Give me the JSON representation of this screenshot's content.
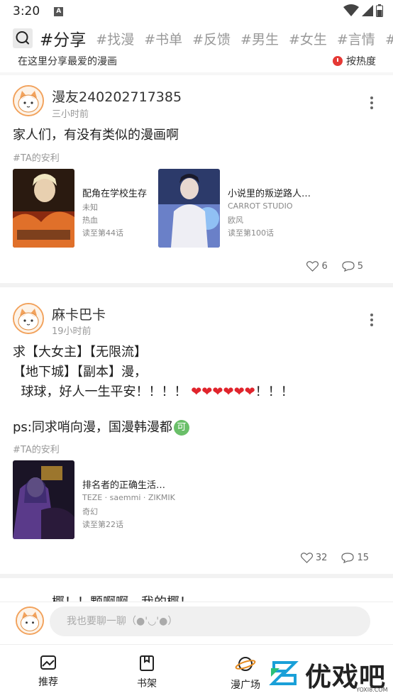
{
  "status_bar": {
    "time": "3:20",
    "notif_letter": "A"
  },
  "tabs": {
    "items": [
      "#分享",
      "#找漫",
      "#书单",
      "#反馈",
      "#男生",
      "#女生",
      "#言情",
      "#耽美",
      "#"
    ],
    "active_index": 0
  },
  "header": {
    "description": "在这里分享最爱的漫画",
    "sort_label": "按热度"
  },
  "posts": [
    {
      "username": "漫友240202717385",
      "time": "三小时前",
      "text": "家人们，有没有类似的漫画啊",
      "tag": "#TA的安利",
      "books": [
        {
          "title": "配角在学校生存",
          "author": "未知",
          "genre": "热血",
          "progress": "读至第44话"
        },
        {
          "title": "小说里的叛逆路人…",
          "author": "CARROT STUDIO",
          "genre": "欧风",
          "progress": "读至第100话"
        }
      ],
      "likes": "6",
      "comments": "5"
    },
    {
      "username": "麻卡巴卡",
      "time": "19小时前",
      "text_lines": [
        "求【大女主】【无限流】",
        "【地下城】【副本】漫，",
        "  球球，好人一生平安！！！！ ❤❤❤❤❤❤！！！"
      ],
      "ps_text": "ps:同求哨向漫，国漫韩漫都",
      "ps_badge": "可",
      "tag": "#TA的安利",
      "books": [
        {
          "title": "排名者的正确生活…",
          "author": "TEZE · saemmi · ZIKMIK",
          "genre": "奇幻",
          "progress": "读至第22话"
        }
      ],
      "likes": "32",
      "comments": "15"
    }
  ],
  "partial_post_text": "椰！！颗啊啊，我的椰！",
  "chat": {
    "placeholder": "我也要聊一聊（●'◡'●）"
  },
  "bottom_nav": [
    {
      "label": "推荐"
    },
    {
      "label": "书架"
    },
    {
      "label": "漫广场"
    }
  ],
  "watermark": {
    "text": "优戏吧",
    "url": "YOXI8.COM"
  },
  "colors": {
    "accent_red": "#e53935",
    "heart_red": "#e0242c",
    "avatar_orange": "#f2a25c",
    "badge_green": "#6abf69"
  }
}
